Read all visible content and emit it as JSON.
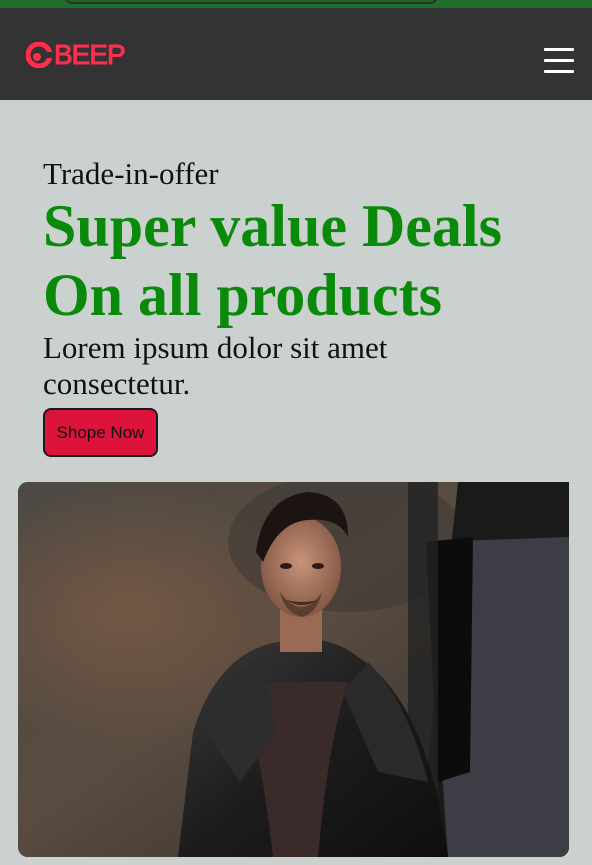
{
  "top_bar": {
    "color": "#1f6f2a"
  },
  "navbar": {
    "background": "#333333",
    "logo_text": "BEEP",
    "logo_color": "#ff2e4f",
    "menu_icon": "hamburger-menu-icon"
  },
  "hero": {
    "eyebrow": "Trade-in-offer",
    "headline_line1": "Super value Deals",
    "headline_line2": "On all products",
    "subtitle": "Lorem ipsum dolor sit amet consectetur.",
    "cta_label": "Shope Now",
    "cta_color": "#dc143c",
    "headline_color": "#0a8a0a",
    "background": "#cbd1ce"
  }
}
